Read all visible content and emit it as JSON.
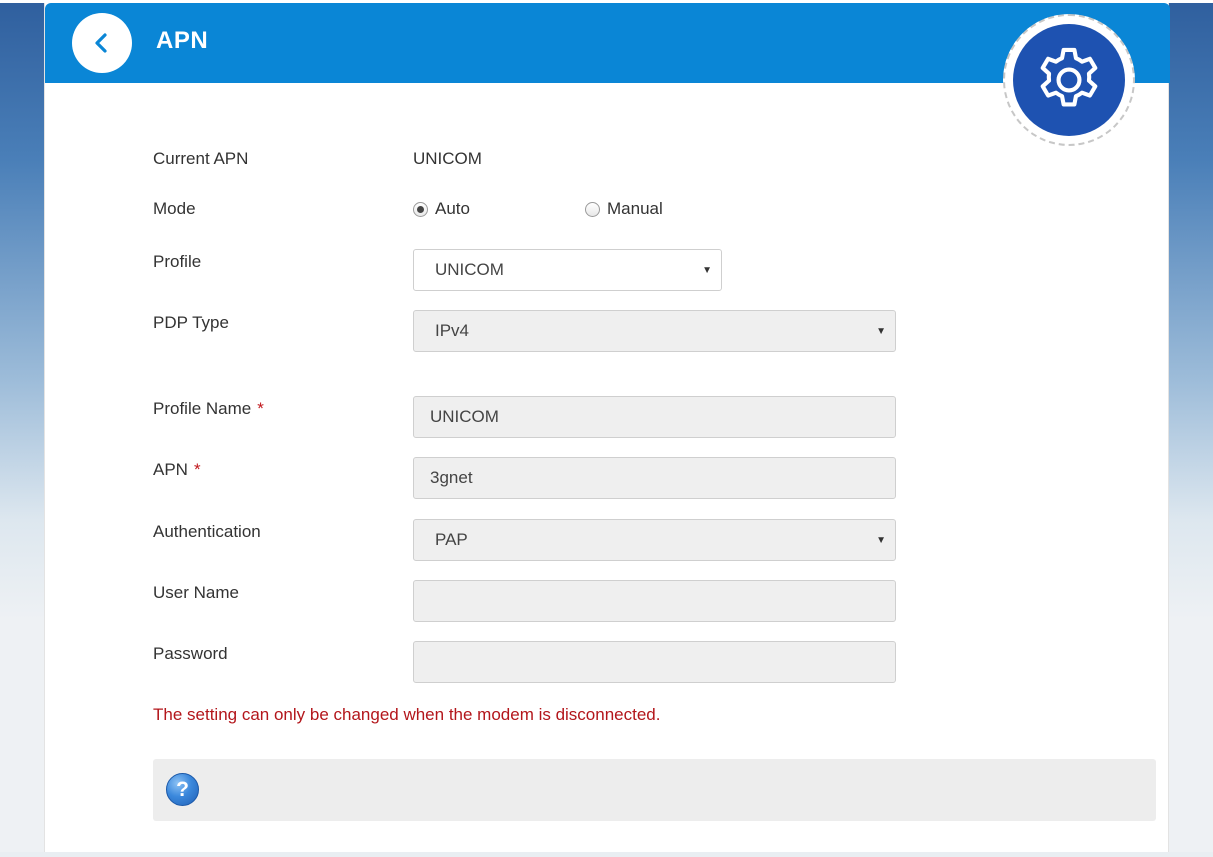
{
  "header": {
    "title": "APN"
  },
  "form": {
    "current_apn": {
      "label": "Current APN",
      "value": "UNICOM"
    },
    "mode": {
      "label": "Mode",
      "options": [
        {
          "label": "Auto",
          "checked": true
        },
        {
          "label": "Manual",
          "checked": false
        }
      ]
    },
    "profile": {
      "label": "Profile",
      "selected": "UNICOM"
    },
    "pdp_type": {
      "label": "PDP Type",
      "selected": "IPv4"
    },
    "profile_name": {
      "label": "Profile Name",
      "required_mark": "*",
      "value": "UNICOM"
    },
    "apn": {
      "label": "APN",
      "required_mark": "*",
      "value": "3gnet"
    },
    "authentication": {
      "label": "Authentication",
      "selected": "PAP"
    },
    "user_name": {
      "label": "User Name",
      "value": ""
    },
    "password": {
      "label": "Password",
      "value": ""
    }
  },
  "warning": "The setting can only be changed when the modem is disconnected.",
  "help": {
    "icon_glyph": "?"
  },
  "colors": {
    "header_bg": "#0a86d6",
    "gear_bg": "#1e52b1",
    "warning_text": "#b3161b",
    "required_mark": "#c0161b"
  },
  "icons": {
    "back": "chevron-left-icon",
    "settings": "gear-icon",
    "help": "question-circle-icon",
    "dropdown": "caret-down-icon"
  }
}
